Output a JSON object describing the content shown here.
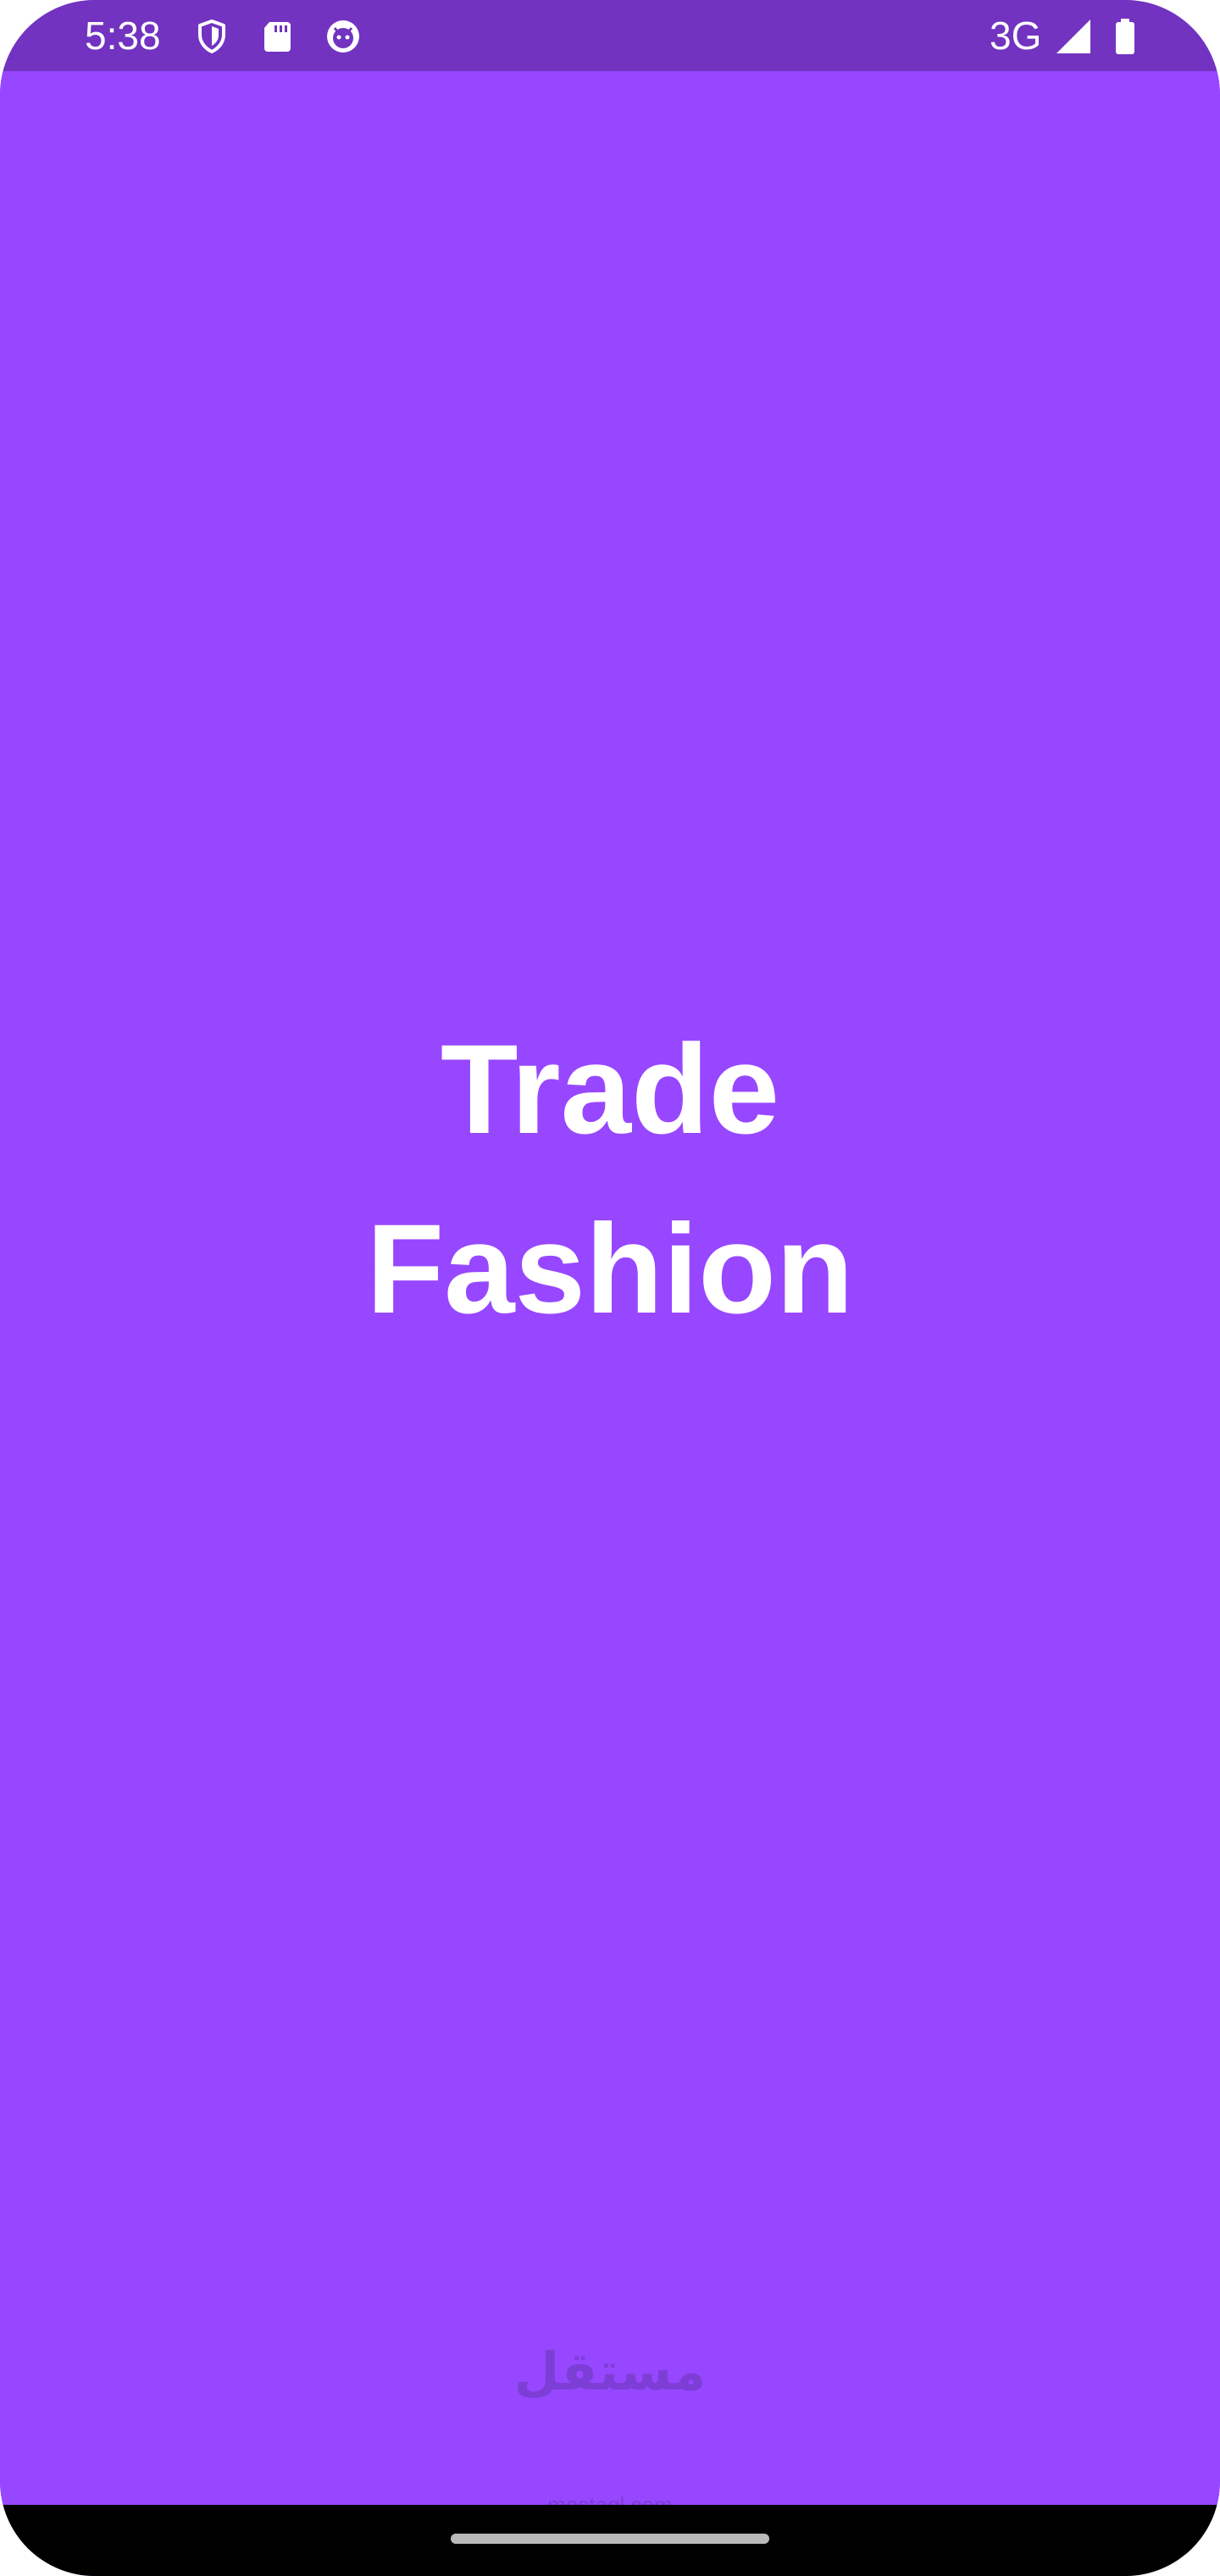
{
  "status_bar": {
    "time": "5:38",
    "network": "3G",
    "icons": [
      "shield-icon",
      "sd-card-icon",
      "app-notification-icon",
      "signal-icon",
      "battery-icon"
    ]
  },
  "main": {
    "title_line1": "Trade",
    "title_line2": "Fashion"
  },
  "watermark": {
    "logo_text": "مستقل",
    "site_text": "mostaql.com"
  },
  "colors": {
    "background": "#9747FF",
    "status_bar": "#7233C0",
    "text": "#FFFFFF",
    "navigation_bar": "#000000"
  }
}
